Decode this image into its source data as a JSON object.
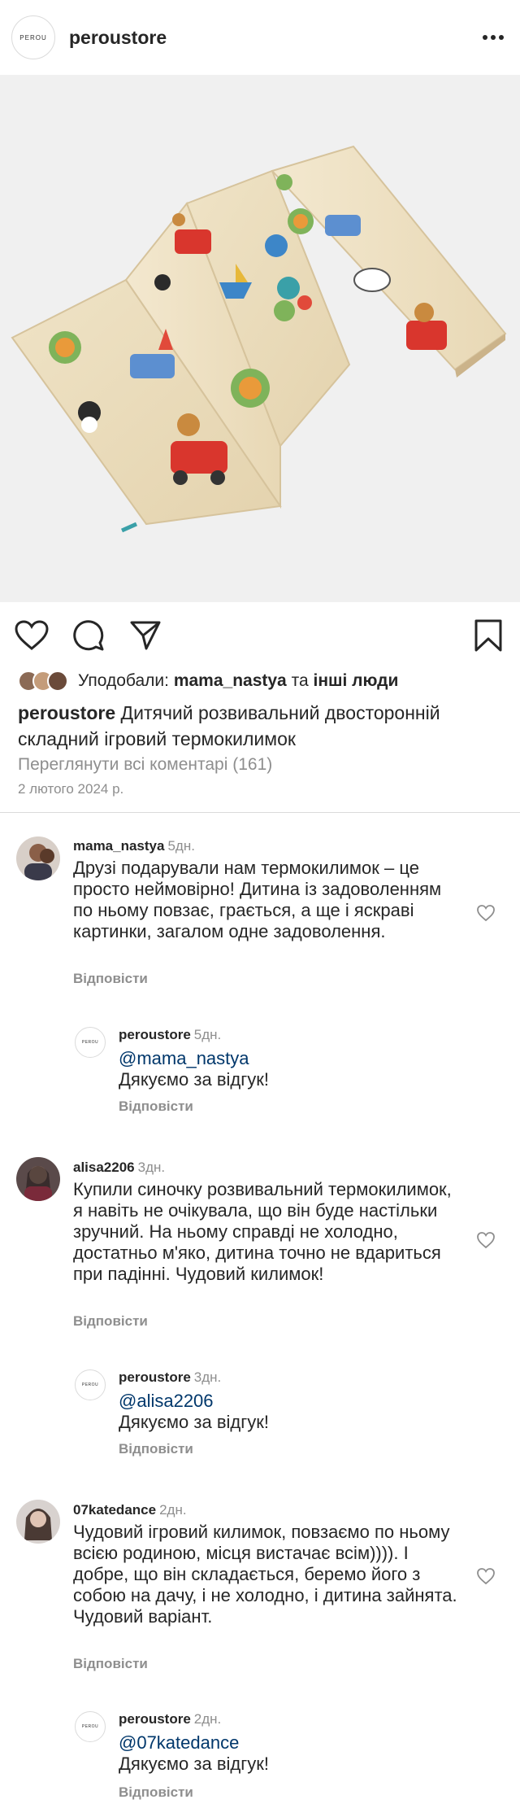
{
  "header": {
    "logo_text": "PEROU",
    "username": "peroustore",
    "more_icon": "more-horizontal-icon"
  },
  "post": {
    "image_alt": "Folding play mat with cartoon prints",
    "likes": {
      "prefix": "Уподобали:",
      "first_user": "mama_nastya",
      "connector": "та",
      "others": "інші люди"
    },
    "caption": {
      "username": "peroustore",
      "text": "Дитячий розвивальний двосторонній складний ігровий термокилимок"
    },
    "view_comments": "Переглянути всі коментарі (161)",
    "date": "2 лютого 2024 р."
  },
  "comments": [
    {
      "username": "mama_nastya",
      "time": "5дн.",
      "text": "Друзі подарували нам термокилимок – це просто неймовірно! Дитина із задоволенням по ньому повзає, грається, а ще і яскраві картинки, загалом одне задоволення.",
      "reply_label": "Відповісти",
      "reply": {
        "username": "peroustore",
        "time": "5дн.",
        "mention": "@mama_nastya",
        "text": "Дякуємо за відгук!",
        "reply_label": "Відповісти"
      }
    },
    {
      "username": "alisa2206",
      "time": "3дн.",
      "text": "Купили синочку розвивальний термокилимок, я навіть не очікувала, що він буде настільки зручний. На ньому справді не холодно, достатньо м'яко, дитина точно не вдариться при падінні. Чудовий килимок!",
      "reply_label": "Відповісти",
      "reply": {
        "username": "peroustore",
        "time": "3дн.",
        "mention": "@alisa2206",
        "text": "Дякуємо за відгук!",
        "reply_label": "Відповісти"
      }
    },
    {
      "username": "07katedance",
      "time": "2дн.",
      "text": "Чудовий ігровий килимок, повзаємо по ньому всією родиною, місця вистачає всім)))). І добре, що він складається, беремо його з собою на дачу, і не холодно, і дитина зайнята. Чудовий варіант.",
      "reply_label": "Відповісти",
      "reply": {
        "username": "peroustore",
        "time": "2дн.",
        "mention": "@07katedance",
        "text": "Дякуємо за відгук!",
        "reply_label": "Відповісти"
      }
    }
  ],
  "reply_logo_text": "PEROU",
  "colors": {
    "text": "#262626",
    "secondary": "#8e8e8e",
    "mention": "#00376b",
    "divider": "#dbdbdb",
    "image_bg": "#f0f0f0"
  }
}
